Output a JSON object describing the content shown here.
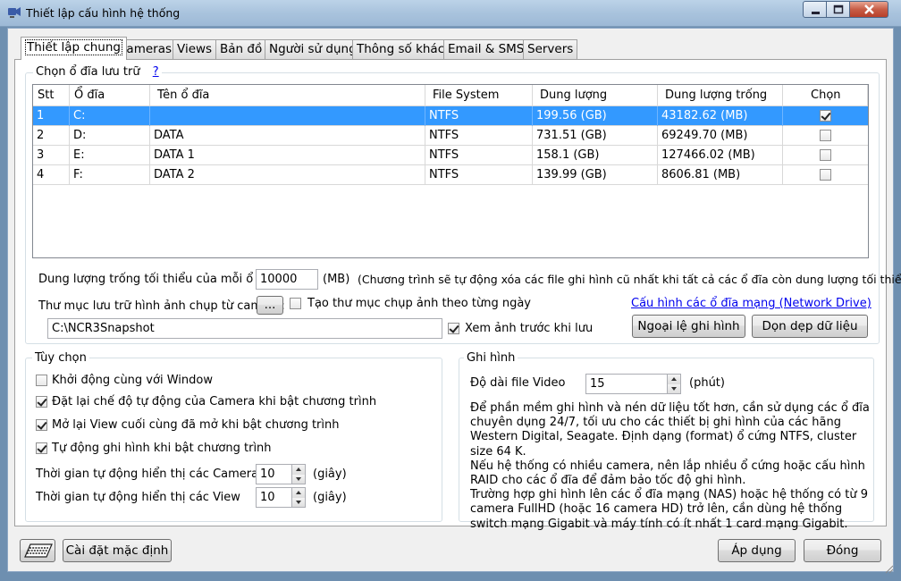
{
  "window": {
    "title": "Thiết lập cấu hình hệ thống"
  },
  "tabs": [
    {
      "label": "Thiết lập chung"
    },
    {
      "label": "Cameras"
    },
    {
      "label": "Views"
    },
    {
      "label": "Bản đồ"
    },
    {
      "label": "Người sử dụng"
    },
    {
      "label": "Thông số khác"
    },
    {
      "label": "Email & SMS"
    },
    {
      "label": "Servers"
    }
  ],
  "storage": {
    "caption": "Chọn ổ đĩa lưu trữ",
    "help": "?",
    "columns": [
      "Stt",
      "Ổ đĩa",
      "Tên ổ đĩa",
      "File System",
      "Dung lượng",
      "Dung lượng trống",
      "Chọn"
    ],
    "rows": [
      {
        "stt": "1",
        "drive": "C:",
        "name": "",
        "fs": "NTFS",
        "size": "199.56  (GB)",
        "free": "43182.62  (MB)",
        "checked": true,
        "selected": true
      },
      {
        "stt": "2",
        "drive": "D:",
        "name": "DATA",
        "fs": "NTFS",
        "size": "731.51  (GB)",
        "free": "69249.70  (MB)",
        "checked": false,
        "selected": false
      },
      {
        "stt": "3",
        "drive": "E:",
        "name": "DATA 1",
        "fs": "NTFS",
        "size": "158.1  (GB)",
        "free": "127466.02  (MB)",
        "checked": false,
        "selected": false
      },
      {
        "stt": "4",
        "drive": "F:",
        "name": "DATA 2",
        "fs": "NTFS",
        "size": "139.99  (GB)",
        "free": "8606.81  (MB)",
        "checked": false,
        "selected": false
      }
    ],
    "min_free_label": "Dung lượng trống tối thiểu của mỗi ổ đĩa:",
    "min_free_value": "10000",
    "min_free_unit": "(MB)",
    "min_free_note": "(Chương trình sẽ tự động xóa các file ghi hình cũ nhất khi tất cả các ổ đĩa còn dung lượng tối thiểu)",
    "snapshot_folder_label": "Thư mục lưu trữ hình ảnh chụp từ camera:",
    "browse_label": "...",
    "daily_folder_label": "Tạo thư mục chụp ảnh theo từng ngày",
    "daily_folder_checked": false,
    "snapshot_path": "C:\\NCR3Snapshot",
    "preview_label": "Xem ảnh trước khi lưu",
    "preview_checked": true,
    "network_drive_link": "Cấu hình các ổ đĩa mạng (Network Drive)",
    "exception_button": "Ngoại lệ ghi hình",
    "cleanup_button": "Dọn dẹp dữ liệu"
  },
  "options": {
    "caption": "Tùy chọn",
    "checks": [
      {
        "label": "Khởi động cùng với Window",
        "checked": false
      },
      {
        "label": "Đặt lại chế độ tự động của Camera khi bật chương trình",
        "checked": true
      },
      {
        "label": "Mở lại View cuối cùng đã mở khi bật chương trình",
        "checked": true
      },
      {
        "label": "Tự động ghi hình khi bật chương trình",
        "checked": true
      }
    ],
    "camera_display_label": "Thời gian tự động hiển thị các Camera",
    "camera_display_value": "10",
    "view_display_label": "Thời gian tự động hiển thị các View",
    "view_display_value": "10",
    "unit": "(giây)"
  },
  "recording": {
    "caption": "Ghi hình",
    "video_length_label": "Độ dài file Video",
    "video_length_value": "15",
    "video_length_unit": "(phút)",
    "note": "Để phần mềm ghi hình và nén dữ liệu tốt hơn, cần sử dụng các ổ đĩa chuyên dụng 24/7, tối ưu cho các thiết bị ghi hình của các hãng Western Digital, Seagate. Định dạng (format) ổ cứng NTFS, cluster size 64 K.\nNếu hệ thống có nhiều camera, nên lắp nhiều ổ cứng hoặc cấu hình RAID cho các ổ đĩa để đảm bảo tốc độ ghi hình.\nTrường hợp ghi hình lên các ổ đĩa mạng (NAS) hoặc hệ thống có từ 9 camera FullHD (hoặc 16 camera HD) trở lên, cần dùng hệ thống switch mạng Gigabit và máy tính có ít nhất 1 card mạng Gigabit."
  },
  "footer": {
    "reset_button": "Cài đặt mặc định",
    "apply_button": "Áp dụng",
    "close_button": "Đóng"
  }
}
